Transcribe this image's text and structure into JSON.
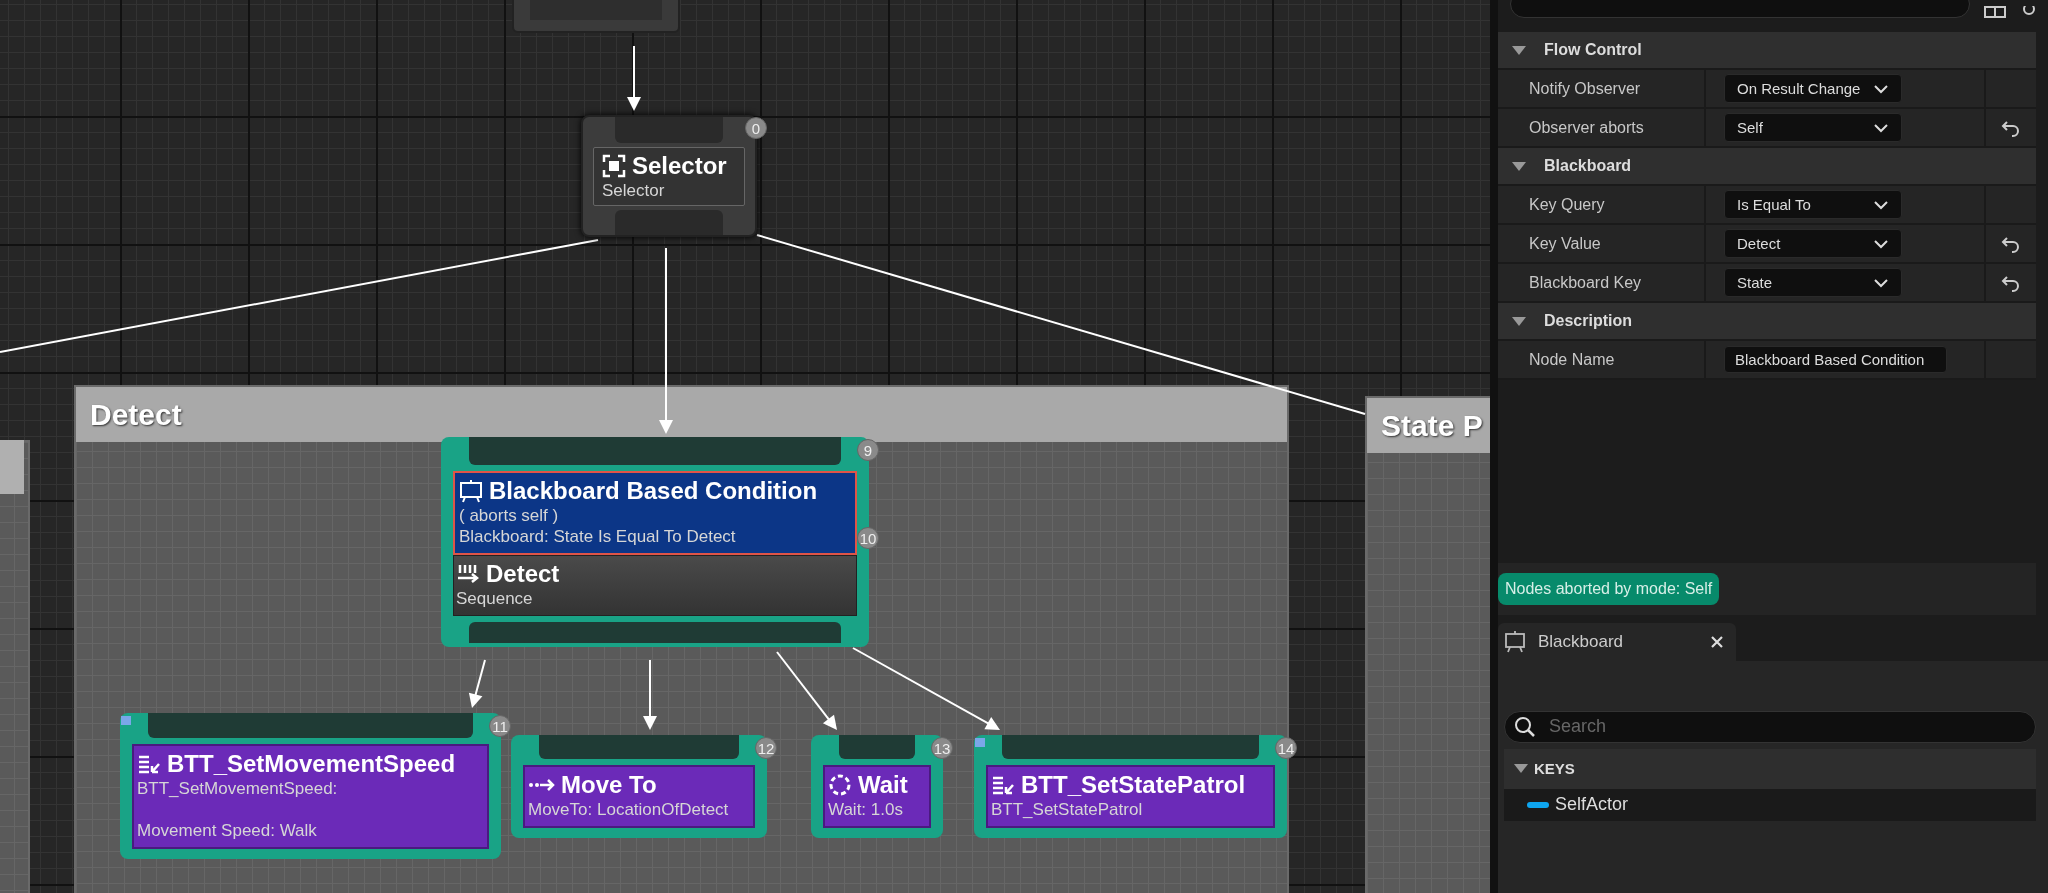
{
  "graph": {
    "comments": [
      {
        "title": "Detect"
      },
      {
        "title": "State P"
      }
    ],
    "selector": {
      "title": "Selector",
      "subtitle": "Selector",
      "index": "0"
    },
    "composite": {
      "index": "9",
      "title": "Detect",
      "subtitle": "Sequence",
      "decorator": {
        "title": "Blackboard Based Condition",
        "description": "( aborts self )\nBlackboard: State Is Equal To Detect",
        "index": "10",
        "selected": true
      }
    },
    "tasks": [
      {
        "kind": "blueprint-task",
        "title": "BTT_SetMovementSpeed",
        "description": "BTT_SetMovementSpeed:\n\nMovement Speed: Walk",
        "index": "11",
        "blueprint": true
      },
      {
        "kind": "move",
        "title": "Move To",
        "description": "MoveTo: LocationOfDetect",
        "index": "12",
        "blueprint": false
      },
      {
        "kind": "wait",
        "title": "Wait",
        "description": "Wait: 1.0s",
        "index": "13",
        "blueprint": false
      },
      {
        "kind": "blueprint-task",
        "title": "BTT_SetStatePatrol",
        "description": "BTT_SetStatePatrol",
        "index": "14",
        "blueprint": true
      }
    ]
  },
  "details": {
    "sections": [
      {
        "title": "Flow Control",
        "expanded": true,
        "rows": [
          {
            "label": "Notify Observer",
            "kind": "dropdown",
            "value": "On Result Change",
            "reset": false
          },
          {
            "label": "Observer aborts",
            "kind": "dropdown",
            "value": "Self",
            "reset": true
          }
        ]
      },
      {
        "title": "Blackboard",
        "expanded": true,
        "rows": [
          {
            "label": "Key Query",
            "kind": "dropdown",
            "value": "Is Equal To",
            "reset": false
          },
          {
            "label": "Key Value",
            "kind": "dropdown",
            "value": "Detect",
            "reset": true
          },
          {
            "label": "Blackboard Key",
            "kind": "dropdown",
            "value": "State",
            "reset": true
          }
        ]
      },
      {
        "title": "Description",
        "expanded": true,
        "rows": [
          {
            "label": "Node Name",
            "kind": "text",
            "value": "Blackboard Based Condition",
            "reset": false
          }
        ]
      }
    ]
  },
  "notice": "Nodes aborted by mode: Self",
  "blackboard": {
    "tab": {
      "label": "Blackboard",
      "selected": true
    },
    "search": {
      "placeholder": "Search"
    },
    "sections": [
      {
        "title": "KEYS",
        "expanded": true,
        "keys": [
          {
            "name": "SelfActor",
            "color": "#0ea5ef"
          }
        ]
      }
    ]
  }
}
